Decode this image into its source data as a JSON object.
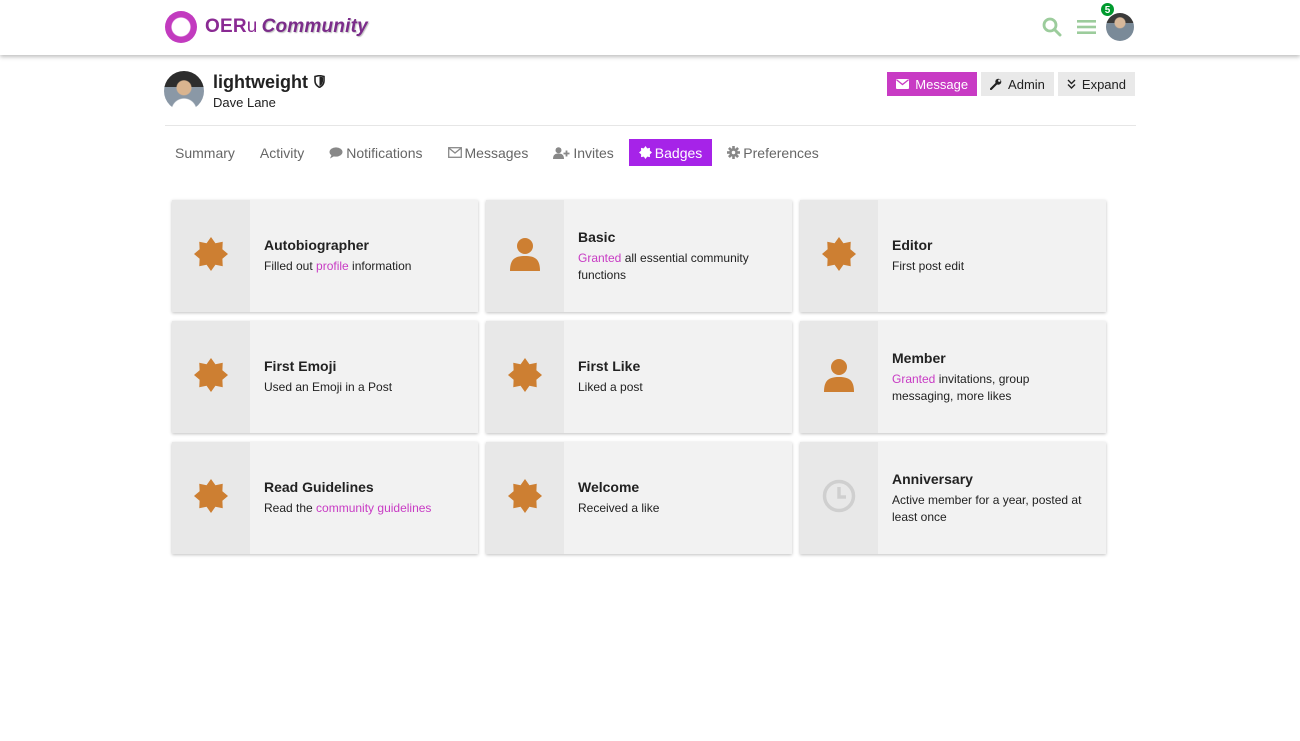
{
  "header": {
    "logo_text_a": "OER",
    "logo_text_u": "u",
    "logo_text_b": "Community",
    "notification_count": "5"
  },
  "user": {
    "username": "lightweight",
    "real_name": "Dave Lane"
  },
  "actions": {
    "message": "Message",
    "admin": "Admin",
    "expand": "Expand"
  },
  "tabs": [
    {
      "label": "Summary"
    },
    {
      "label": "Activity"
    },
    {
      "label": "Notifications"
    },
    {
      "label": "Messages"
    },
    {
      "label": "Invites"
    },
    {
      "label": "Badges"
    },
    {
      "label": "Preferences"
    }
  ],
  "badges": [
    {
      "title": "Autobiographer",
      "d1": "Filled out ",
      "link": "profile",
      "d2": " information",
      "icon": "certificate-icon"
    },
    {
      "title": "Basic",
      "d1": "",
      "link": "Granted",
      "d2": " all essential community functions",
      "icon": "user-icon"
    },
    {
      "title": "Editor",
      "d1": "First post edit",
      "link": "",
      "d2": "",
      "icon": "certificate-icon"
    },
    {
      "title": "First Emoji",
      "d1": "Used an Emoji in a Post",
      "link": "",
      "d2": "",
      "icon": "certificate-icon"
    },
    {
      "title": "First Like",
      "d1": "Liked a post",
      "link": "",
      "d2": "",
      "icon": "certificate-icon"
    },
    {
      "title": "Member",
      "d1": "",
      "link": "Granted",
      "d2": " invitations, group messaging, more likes",
      "icon": "user-icon"
    },
    {
      "title": "Read Guidelines",
      "d1": "Read the ",
      "link": "community guidelines",
      "d2": "",
      "icon": "certificate-icon"
    },
    {
      "title": "Welcome",
      "d1": "Received a like",
      "link": "",
      "d2": "",
      "icon": "certificate-icon"
    },
    {
      "title": "Anniversary",
      "d1": "Active member for a year, posted at least once",
      "link": "",
      "d2": "",
      "icon": "clock-icon"
    }
  ],
  "colors": {
    "accent": "#c83bc4",
    "active_tab": "#a623e8",
    "badge_bronze": "#cd7f32",
    "header_icons": "#9ccc9c"
  }
}
